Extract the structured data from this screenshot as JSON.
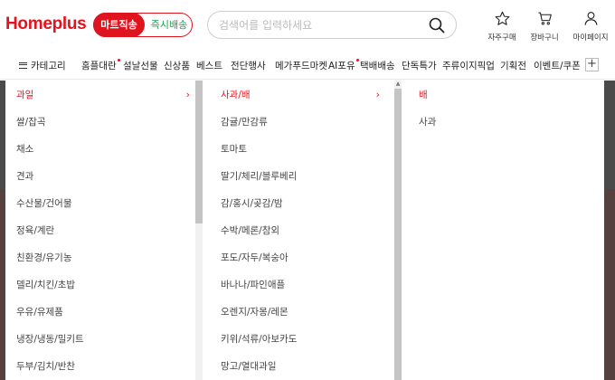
{
  "header": {
    "logo": "Homeplus",
    "toggle_active": "마트직송",
    "toggle_inactive": "즉시배송",
    "search_placeholder": "검색어를 입력하세요",
    "icons": [
      {
        "name": "star-icon",
        "label": "자주구매"
      },
      {
        "name": "cart-icon",
        "label": "장바구니"
      },
      {
        "name": "user-icon",
        "label": "마이페이지"
      }
    ]
  },
  "nav": {
    "category_label": "카테고리",
    "items": [
      "홈플대란",
      "설날선물",
      "신상품",
      "베스트",
      "전단행사",
      "메가푸드마켓",
      "AI포유",
      "택배배송",
      "단독특가",
      "주류이지픽업",
      "기획전",
      "이벤트/쿠폰"
    ],
    "dotted": [
      "홈플대란",
      "AI포유"
    ],
    "more_label": "+"
  },
  "menu": {
    "level1": [
      "과일",
      "쌀/잡곡",
      "채소",
      "견과",
      "수산물/건어물",
      "정육/계란",
      "친환경/유기농",
      "델리/치킨/초밥",
      "우유/유제품",
      "냉장/냉동/밀키트",
      "두부/김치/반찬"
    ],
    "level1_selected": "과일",
    "level2": [
      "사과/배",
      "감귤/만감류",
      "토마토",
      "딸기/체리/블루베리",
      "감/홍시/곶감/밤",
      "수박/메론/참외",
      "포도/자두/복숭아",
      "바나나/파인애플",
      "오렌지/자몽/레몬",
      "키위/석류/아보카도",
      "망고/열대과일"
    ],
    "level2_selected": "사과/배",
    "level3": [
      "배",
      "사과"
    ],
    "level3_selected": "배",
    "chevron": "›"
  },
  "colors": {
    "brand_red": "#e0141e",
    "delivery_green": "#17a34a"
  }
}
